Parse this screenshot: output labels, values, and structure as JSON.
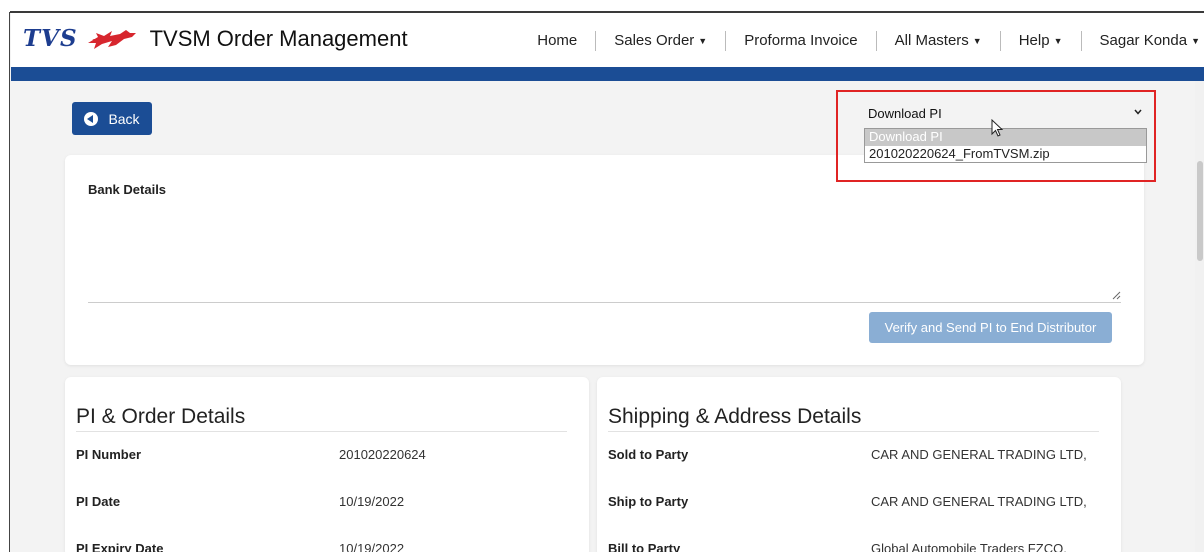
{
  "header": {
    "logo_text": "TVS",
    "app_title": "TVSM Order Management",
    "nav": [
      {
        "label": "Home"
      },
      {
        "label": "Sales Order"
      },
      {
        "label": "Proforma Invoice"
      },
      {
        "label": "All Masters"
      },
      {
        "label": "Help"
      },
      {
        "label": "Sagar Konda"
      }
    ]
  },
  "back_button": {
    "label": "Back"
  },
  "download_select": {
    "value": "Download PI",
    "options": [
      "Download PI",
      "201020220624_FromTVSM.zip"
    ]
  },
  "bank": {
    "title": "Bank Details",
    "textarea_value": "",
    "verify_label": "Verify and Send PI to End Distributor"
  },
  "pi_details": {
    "title": "PI & Order Details",
    "rows": [
      {
        "key": "PI Number",
        "value": "201020220624"
      },
      {
        "key": "PI Date",
        "value": "10/19/2022"
      },
      {
        "key": "PI Expiry Date",
        "value": "10/19/2022"
      }
    ]
  },
  "shipping": {
    "title": "Shipping & Address Details",
    "rows": [
      {
        "key": "Sold to Party",
        "value": "CAR AND GENERAL TRADING LTD,"
      },
      {
        "key": "Ship to Party",
        "value": "CAR AND GENERAL TRADING LTD,"
      },
      {
        "key": "Bill to Party",
        "value": "Global Automobile Traders FZCO,"
      }
    ]
  },
  "colors": {
    "brand_blue": "#1b4d95",
    "button_disabled": "#8aaed4",
    "highlight_red": "#e02424"
  }
}
